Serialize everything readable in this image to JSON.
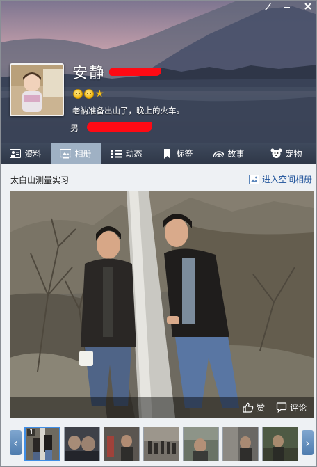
{
  "window": {
    "skin_icon": "brush-icon",
    "min_icon": "minimize-icon",
    "close_icon": "close-icon"
  },
  "profile": {
    "name": "安静",
    "signature": "老衲准备出山了，晚上的火车。",
    "gender": "男",
    "level_icons": [
      "sun-face-icon",
      "sun-face-icon",
      "star-icon"
    ]
  },
  "tabs": [
    {
      "label": "资料",
      "icon": "profile-card-icon",
      "active": false
    },
    {
      "label": "相册",
      "icon": "photo-album-icon",
      "active": true
    },
    {
      "label": "动态",
      "icon": "feed-list-icon",
      "active": false
    },
    {
      "label": "标签",
      "icon": "bookmark-icon",
      "active": false
    },
    {
      "label": "故事",
      "icon": "rainbow-icon",
      "active": false
    },
    {
      "label": "宠物",
      "icon": "pet-icon",
      "active": false
    }
  ],
  "album": {
    "title": "太白山测量实习",
    "enter_link": "进入空间相册",
    "like_label": "赞",
    "comment_label": "评论",
    "active_thumb_number": "1"
  },
  "colors": {
    "accent": "#3f8ee6",
    "tab_active": "#9fb1c4",
    "redaction": "#ff0a14"
  }
}
